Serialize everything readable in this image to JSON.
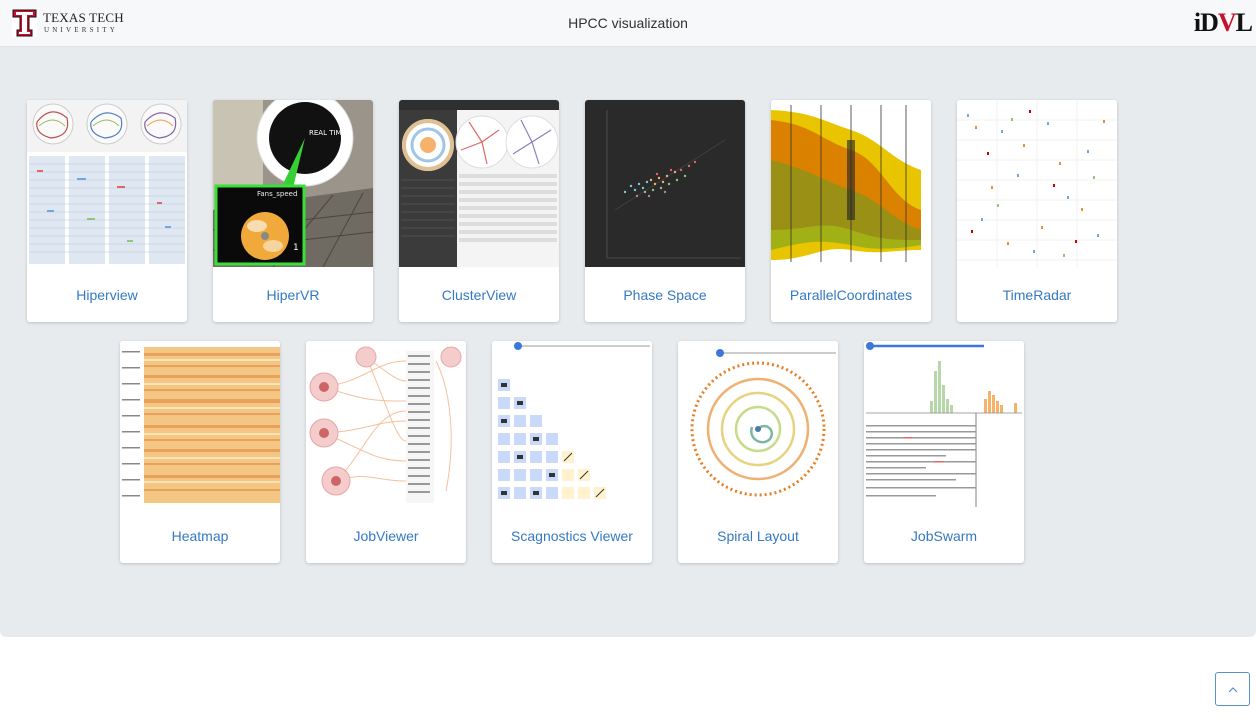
{
  "header": {
    "org_logo_name": "TEXAS TECH",
    "org_logo_sub": "UNIVERSITY",
    "title": "HPCC visualization",
    "lab_logo_prefix": "iD",
    "lab_logo_red": "V",
    "lab_logo_suffix": "L"
  },
  "gallery": {
    "items": [
      {
        "label": "Hiperview",
        "thumbnail": "hiperview-thumbnail"
      },
      {
        "label": "HiperVR",
        "thumbnail": "hipervr-thumbnail"
      },
      {
        "label": "ClusterView",
        "thumbnail": "clusterview-thumbnail"
      },
      {
        "label": "Phase Space",
        "thumbnail": "phase-space-thumbnail"
      },
      {
        "label": "ParallelCoordinates",
        "thumbnail": "parallel-coordinates-thumbnail"
      },
      {
        "label": "TimeRadar",
        "thumbnail": "timeradar-thumbnail"
      },
      {
        "label": "Heatmap",
        "thumbnail": "heatmap-thumbnail"
      },
      {
        "label": "JobViewer",
        "thumbnail": "jobviewer-thumbnail"
      },
      {
        "label": "Scagnostics Viewer",
        "thumbnail": "scagnostics-thumbnail"
      },
      {
        "label": "Spiral Layout",
        "thumbnail": "spiral-thumbnail"
      },
      {
        "label": "JobSwarm",
        "thumbnail": "jobswarm-thumbnail"
      }
    ]
  },
  "thumb_text": {
    "hipervr_gauge": "REAL TIME",
    "hipervr_panel": "Fans_speed",
    "hipervr_num": "1"
  },
  "colors": {
    "link": "#3479c4",
    "background": "#e8ebee",
    "ttu_red": "#c8102e"
  },
  "scroll_top": {
    "icon": "chevron-up-icon"
  }
}
